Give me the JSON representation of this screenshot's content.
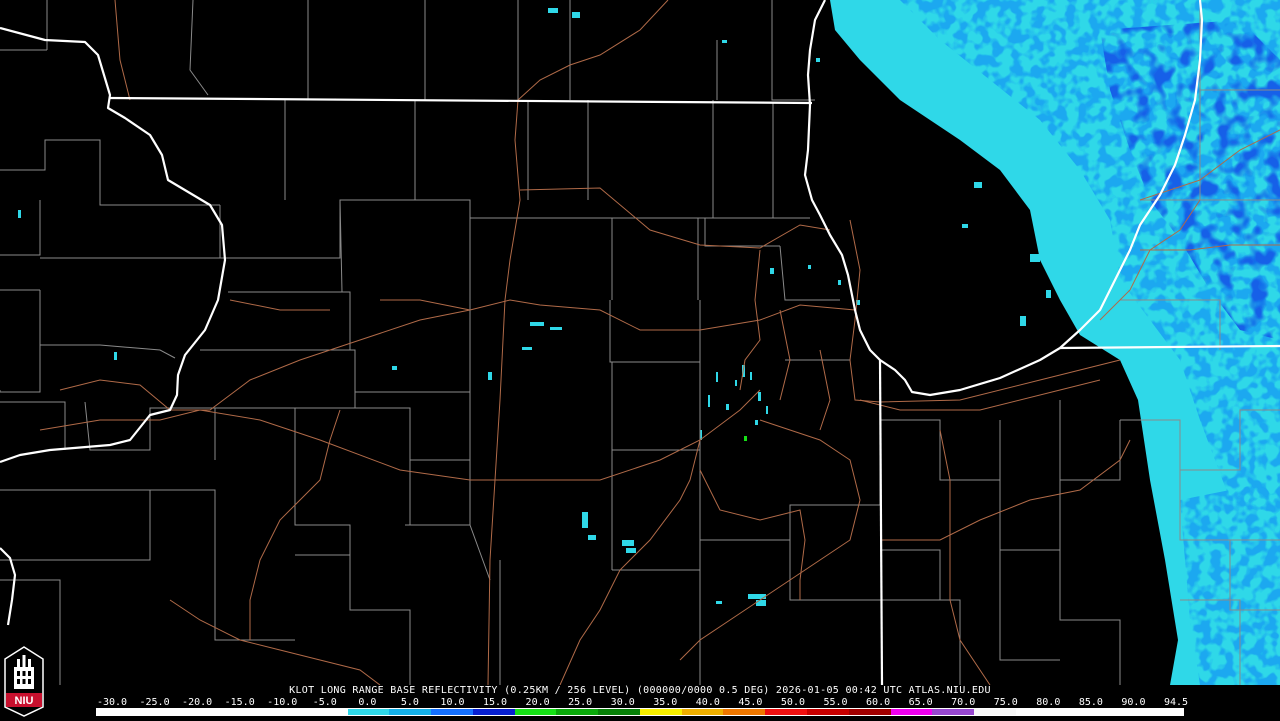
{
  "caption": {
    "station": "KLOT",
    "product": "LONG RANGE BASE REFLECTIVITY",
    "resolution": "(0.25KM / 256 LEVEL)",
    "volume": "(000000/0000 0.5 DEG)",
    "date": "2026-01-05",
    "time": "00:42 UTC",
    "source": "ATLAS.NIU.EDU"
  },
  "scale_ticks": [
    "-30.0",
    "-25.0",
    "-20.0",
    "-15.0",
    "-10.0",
    "-5.0",
    "0.0",
    "5.0",
    "10.0",
    "15.0",
    "20.0",
    "25.0",
    "30.0",
    "35.0",
    "40.0",
    "45.0",
    "50.0",
    "55.0",
    "60.0",
    "65.0",
    "70.0",
    "75.0",
    "80.0",
    "85.0",
    "90.0",
    "94.5"
  ],
  "scale_colors": [
    "#ffffff",
    "#ffffff",
    "#ffffff",
    "#ffffff",
    "#ffffff",
    "#ffffff",
    "#2fd8e8",
    "#14b0e8",
    "#1470ff",
    "#0820d0",
    "#16e016",
    "#0aa80a",
    "#078007",
    "#f8f000",
    "#f0b000",
    "#f07800",
    "#f01010",
    "#c80000",
    "#a00000",
    "#f000f0",
    "#9848d0",
    "#f8f8f8",
    "#ffffff",
    "#ffffff",
    "#ffffff",
    "#ffffff"
  ],
  "logo": {
    "text": "NIU",
    "colors": {
      "background": "#c8102e",
      "emblem": "#ffffff"
    }
  },
  "map_colors": {
    "background": "#000000",
    "state_border": "#ffffff",
    "county_line": "#8a8a8a",
    "highway": "#b06a48",
    "echo_light": "#2fd8e8",
    "echo_medium": "#1aa8f0",
    "echo_heavy": "#1460e8",
    "echo_green": "#16e016"
  }
}
